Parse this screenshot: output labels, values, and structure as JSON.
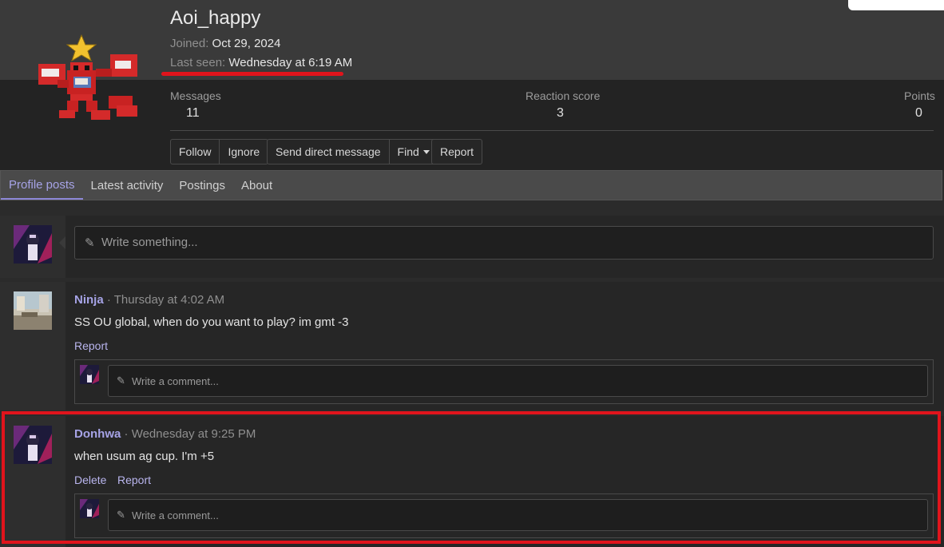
{
  "profile": {
    "username": "Aoi_happy",
    "joined_label": "Joined:",
    "joined_value": "Oct 29, 2024",
    "last_seen_label": "Last seen:",
    "last_seen_value": "Wednesday at 6:19 AM"
  },
  "stats": {
    "messages_label": "Messages",
    "messages_value": "11",
    "reaction_label": "Reaction score",
    "reaction_value": "3",
    "points_label": "Points",
    "points_value": "0"
  },
  "actions": {
    "follow": "Follow",
    "ignore": "Ignore",
    "send_dm": "Send direct message",
    "find": "Find",
    "report": "Report"
  },
  "tabs": [
    {
      "label": "Profile posts",
      "active": true
    },
    {
      "label": "Latest activity"
    },
    {
      "label": "Postings"
    },
    {
      "label": "About"
    }
  ],
  "composer": {
    "placeholder": "Write something..."
  },
  "posts": [
    {
      "author": "Ninja",
      "time": "Thursday at 4:02 AM",
      "body": "SS OU global, when do you want to play? im gmt -3",
      "actions": [
        "Report"
      ],
      "comment_placeholder": "Write a comment..."
    },
    {
      "author": "Donhwa",
      "time": "Wednesday at 9:25 PM",
      "body": "when usum ag cup. I'm +5",
      "actions": [
        "Delete",
        "Report"
      ],
      "comment_placeholder": "Write a comment..."
    }
  ],
  "separator": "·",
  "colors": {
    "accent": "#a6a3e6",
    "highlight": "#e0141c"
  }
}
